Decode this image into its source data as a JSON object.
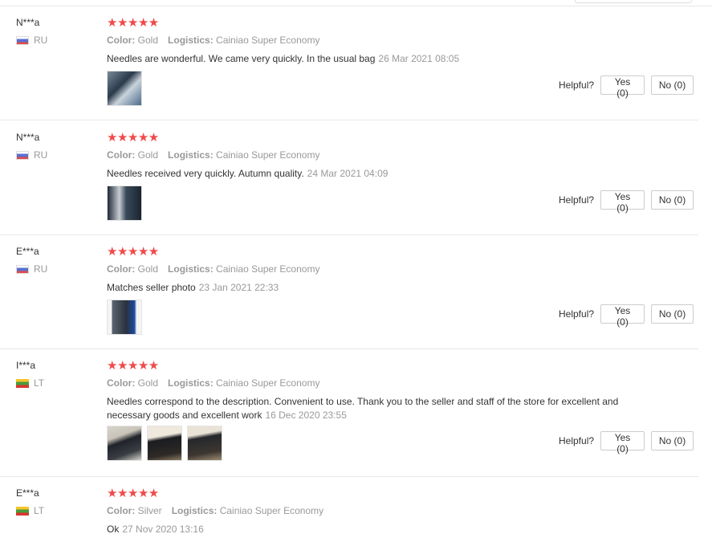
{
  "helpful_label": "Helpful?",
  "color_label": "Color:",
  "logistics_label": "Logistics:",
  "reviews": [
    {
      "user": "N***a",
      "country": "RU",
      "stars": "★★★★★",
      "color": "Gold",
      "logistics": "Cainiao Super Economy",
      "text": "Needles are wonderful. We came very quickly. In the usual bag",
      "date": "26 Mar 2021 08:05",
      "yes": "Yes (0)",
      "no": "No (0)"
    },
    {
      "user": "N***a",
      "country": "RU",
      "stars": "★★★★★",
      "color": "Gold",
      "logistics": "Cainiao Super Economy",
      "text": "Needles received very quickly. Autumn quality.",
      "date": "24 Mar 2021 04:09",
      "yes": "Yes (0)",
      "no": "No (0)"
    },
    {
      "user": "E***a",
      "country": "RU",
      "stars": "★★★★★",
      "color": "Gold",
      "logistics": "Cainiao Super Economy",
      "text": "Matches seller photo",
      "date": "23 Jan 2021 22:33",
      "yes": "Yes (0)",
      "no": "No (0)"
    },
    {
      "user": "I***a",
      "country": "LT",
      "stars": "★★★★★",
      "color": "Gold",
      "logistics": "Cainiao Super Economy",
      "text": "Needles correspond to the description. Convenient to use. Thank you to the seller and staff of the store for excellent and necessary goods and excellent work",
      "date": "16 Dec 2020 23:55",
      "yes": "Yes (0)",
      "no": "No (0)"
    },
    {
      "user": "E***a",
      "country": "LT",
      "stars": "★★★★★",
      "color": "Silver",
      "logistics": "Cainiao Super Economy",
      "text": "Ok",
      "date": "27 Nov 2020 13:16"
    }
  ]
}
